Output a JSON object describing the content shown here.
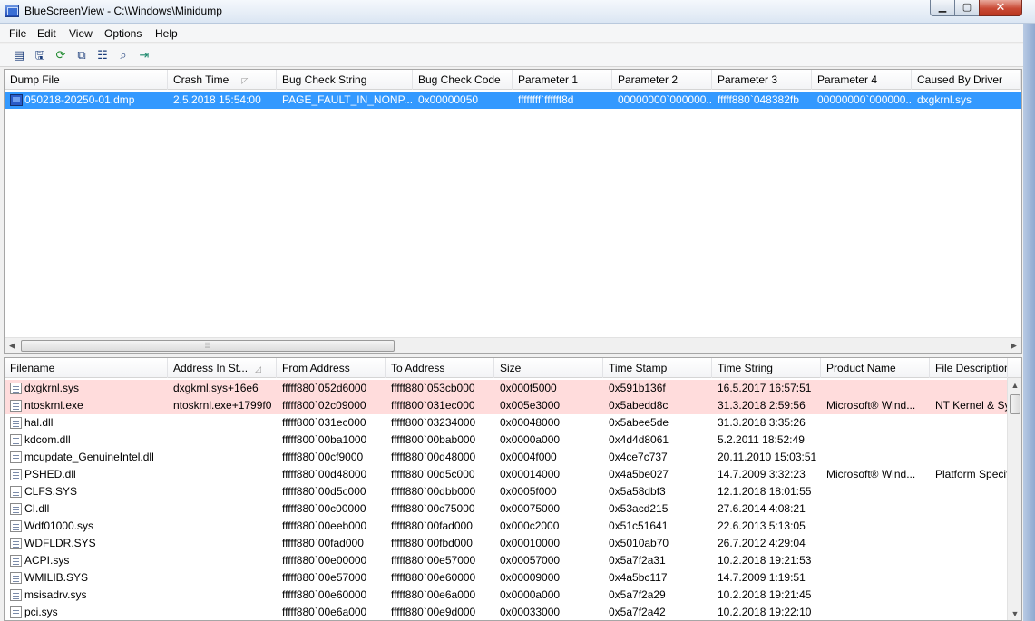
{
  "window": {
    "title": "BlueScreenView  -  C:\\Windows\\Minidump"
  },
  "menu": [
    "File",
    "Edit",
    "View",
    "Options",
    "Help"
  ],
  "toolbar_icons": [
    "html-report-icon",
    "save-icon",
    "refresh-icon",
    "copy-icon",
    "properties-icon",
    "find-icon",
    "exit-icon"
  ],
  "top_table": {
    "columns": [
      "Dump File",
      "Crash Time",
      "Bug Check String",
      "Bug Check Code",
      "Parameter 1",
      "Parameter 2",
      "Parameter 3",
      "Parameter 4",
      "Caused By Driver"
    ],
    "rows": [
      [
        "050218-20250-01.dmp",
        "2.5.2018 15:54:00",
        "PAGE_FAULT_IN_NONP...",
        "0x00000050",
        "ffffffff`ffffff8d",
        "00000000`000000...",
        "fffff880`048382fb",
        "00000000`000000...",
        "dxgkrnl.sys"
      ]
    ]
  },
  "bottom_table": {
    "columns": [
      "Filename",
      "Address In St...",
      "From Address",
      "To Address",
      "Size",
      "Time Stamp",
      "Time String",
      "Product Name",
      "File Description"
    ],
    "rows": [
      [
        "dxgkrnl.sys",
        "dxgkrnl.sys+16e6",
        "fffff880`052d6000",
        "fffff880`053cb000",
        "0x000f5000",
        "0x591b136f",
        "16.5.2017 16:57:51",
        "",
        ""
      ],
      [
        "ntoskrnl.exe",
        "ntoskrnl.exe+1799f0",
        "fffff800`02c09000",
        "fffff800`031ec000",
        "0x005e3000",
        "0x5abedd8c",
        "31.3.2018 2:59:56",
        "Microsoft® Wind...",
        "NT Kernel & System"
      ],
      [
        "hal.dll",
        "",
        "fffff800`031ec000",
        "fffff800`03234000",
        "0x00048000",
        "0x5abee5de",
        "31.3.2018 3:35:26",
        "",
        ""
      ],
      [
        "kdcom.dll",
        "",
        "fffff800`00ba1000",
        "fffff800`00bab000",
        "0x0000a000",
        "0x4d4d8061",
        "5.2.2011 18:52:49",
        "",
        ""
      ],
      [
        "mcupdate_GenuineIntel.dll",
        "",
        "fffff880`00cf9000",
        "fffff880`00d48000",
        "0x0004f000",
        "0x4ce7c737",
        "20.11.2010 15:03:51",
        "",
        ""
      ],
      [
        "PSHED.dll",
        "",
        "fffff880`00d48000",
        "fffff880`00d5c000",
        "0x00014000",
        "0x4a5be027",
        "14.7.2009 3:32:23",
        "Microsoft® Wind...",
        "Platform Specific"
      ],
      [
        "CLFS.SYS",
        "",
        "fffff880`00d5c000",
        "fffff880`00dbb000",
        "0x0005f000",
        "0x5a58dbf3",
        "12.1.2018 18:01:55",
        "",
        ""
      ],
      [
        "CI.dll",
        "",
        "fffff880`00c00000",
        "fffff880`00c75000",
        "0x00075000",
        "0x53acd215",
        "27.6.2014 4:08:21",
        "",
        ""
      ],
      [
        "Wdf01000.sys",
        "",
        "fffff880`00eeb000",
        "fffff880`00fad000",
        "0x000c2000",
        "0x51c51641",
        "22.6.2013 5:13:05",
        "",
        ""
      ],
      [
        "WDFLDR.SYS",
        "",
        "fffff880`00fad000",
        "fffff880`00fbd000",
        "0x00010000",
        "0x5010ab70",
        "26.7.2012 4:29:04",
        "",
        ""
      ],
      [
        "ACPI.sys",
        "",
        "fffff880`00e00000",
        "fffff880`00e57000",
        "0x00057000",
        "0x5a7f2a31",
        "10.2.2018 19:21:53",
        "",
        ""
      ],
      [
        "WMILIB.SYS",
        "",
        "fffff880`00e57000",
        "fffff880`00e60000",
        "0x00009000",
        "0x4a5bc117",
        "14.7.2009 1:19:51",
        "",
        ""
      ],
      [
        "msisadrv.sys",
        "",
        "fffff880`00e60000",
        "fffff880`00e6a000",
        "0x0000a000",
        "0x5a7f2a29",
        "10.2.2018 19:21:45",
        "",
        ""
      ],
      [
        "pci.sys",
        "",
        "fffff880`00e6a000",
        "fffff880`00e9d000",
        "0x00033000",
        "0x5a7f2a42",
        "10.2.2018 19:22:10",
        "",
        ""
      ]
    ]
  }
}
